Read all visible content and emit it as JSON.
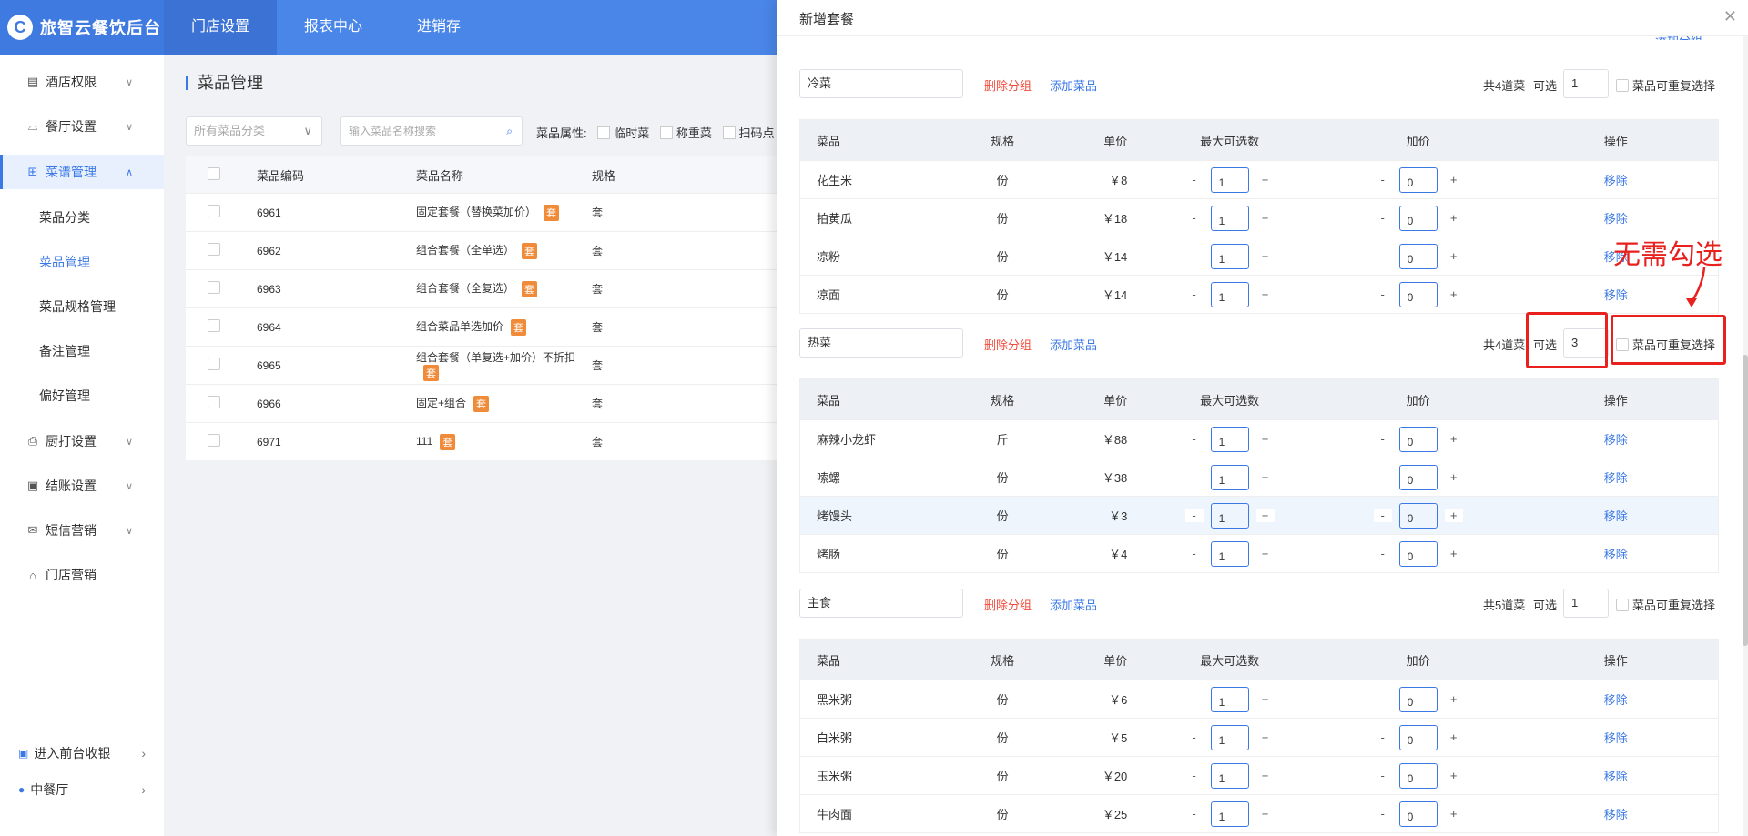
{
  "brand": {
    "name": "旅智云餐饮后台",
    "logo": "C"
  },
  "topnav": [
    {
      "label": "门店设置"
    },
    {
      "label": "报表中心"
    },
    {
      "label": "进销存"
    }
  ],
  "sidebar": {
    "items": [
      {
        "label": "酒店权限",
        "icon": "building-icon"
      },
      {
        "label": "餐厅设置",
        "icon": "dish-icon"
      },
      {
        "label": "菜谱管理",
        "icon": "grid-icon"
      },
      {
        "label": "厨打设置",
        "icon": "printer-icon"
      },
      {
        "label": "结账设置",
        "icon": "cashier-icon"
      },
      {
        "label": "短信营销",
        "icon": "mail-icon"
      },
      {
        "label": "门店营销",
        "icon": "store-icon"
      }
    ],
    "subitems": [
      "菜品分类",
      "菜品管理",
      "菜品规格管理",
      "备注管理",
      "偏好管理"
    ],
    "bottom": [
      {
        "label": "进入前台收银",
        "icon": "cashier-icon"
      },
      {
        "label": "中餐厅",
        "icon": "location-icon"
      }
    ]
  },
  "main": {
    "title": "菜品管理",
    "category_placeholder": "所有菜品分类",
    "search_placeholder": "输入菜品名称搜索",
    "attr_label": "菜品属性:",
    "attrs": [
      "临时菜",
      "称重菜",
      "扫码点"
    ],
    "columns": [
      "菜品编码",
      "菜品名称",
      "规格"
    ],
    "tao_label": "套",
    "rows": [
      {
        "code": "6961",
        "name": "固定套餐（替换菜加价）",
        "spec": "套"
      },
      {
        "code": "6962",
        "name": "组合套餐（全单选）",
        "spec": "套"
      },
      {
        "code": "6963",
        "name": "组合套餐（全复选）",
        "spec": "套"
      },
      {
        "code": "6964",
        "name": "组合菜品单选加价",
        "spec": "套"
      },
      {
        "code": "6965",
        "name": "组合套餐（单复选+加价）不折扣",
        "spec": "套"
      },
      {
        "code": "6966",
        "name": "固定+组合",
        "spec": "套"
      },
      {
        "code": "6971",
        "name": "111",
        "spec": "套"
      }
    ]
  },
  "drawer": {
    "title": "新增套餐",
    "peek_link": "添加分组",
    "delete_group": "删除分组",
    "add_dish": "添加菜品",
    "optional_label": "可选",
    "repeat_label": "菜品可重复选择",
    "columns": {
      "name": "菜品",
      "spec": "规格",
      "price": "单价",
      "max": "最大可选数",
      "add": "加价",
      "op": "操作"
    },
    "remove_label": "移除",
    "minus": "-",
    "plus": "+",
    "groups": [
      {
        "name": "冷菜",
        "total": "共4道菜",
        "optional": "1",
        "rows": [
          {
            "name": "花生米",
            "spec": "份",
            "price": "￥8",
            "max": "1",
            "add": "0"
          },
          {
            "name": "拍黄瓜",
            "spec": "份",
            "price": "￥18",
            "max": "1",
            "add": "0"
          },
          {
            "name": "凉粉",
            "spec": "份",
            "price": "￥14",
            "max": "1",
            "add": "0"
          },
          {
            "name": "凉面",
            "spec": "份",
            "price": "￥14",
            "max": "1",
            "add": "0"
          }
        ]
      },
      {
        "name": "热菜",
        "total": "共4道菜",
        "optional": "3",
        "rows": [
          {
            "name": "麻辣小龙虾",
            "spec": "斤",
            "price": "￥88",
            "max": "1",
            "add": "0"
          },
          {
            "name": "嗦螺",
            "spec": "份",
            "price": "￥38",
            "max": "1",
            "add": "0"
          },
          {
            "name": "烤馒头",
            "spec": "份",
            "price": "￥3",
            "max": "1",
            "add": "0"
          },
          {
            "name": "烤肠",
            "spec": "份",
            "price": "￥4",
            "max": "1",
            "add": "0"
          }
        ]
      },
      {
        "name": "主食",
        "total": "共5道菜",
        "optional": "1",
        "rows": [
          {
            "name": "黑米粥",
            "spec": "份",
            "price": "￥6",
            "max": "1",
            "add": "0"
          },
          {
            "name": "白米粥",
            "spec": "份",
            "price": "￥5",
            "max": "1",
            "add": "0"
          },
          {
            "name": "玉米粥",
            "spec": "份",
            "price": "￥20",
            "max": "1",
            "add": "0"
          },
          {
            "name": "牛肉面",
            "spec": "份",
            "price": "￥25",
            "max": "1",
            "add": "0"
          }
        ]
      }
    ]
  },
  "annotation": {
    "text": "无需勾选",
    "color": "#e8201e"
  },
  "colors": {
    "primary": "#4a86e8",
    "link": "#3a78e6",
    "danger": "#f04b3a",
    "tag": "#f08b3a"
  }
}
